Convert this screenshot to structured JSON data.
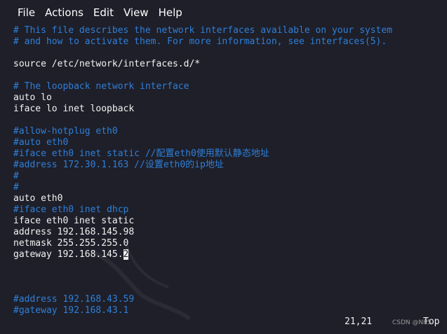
{
  "menu": [
    "File",
    "Actions",
    "Edit",
    "View",
    "Help"
  ],
  "lines": [
    {
      "type": "comment",
      "text": "# This file describes the network interfaces available on your system"
    },
    {
      "type": "comment",
      "text": "# and how to activate them. For more information, see interfaces(5)."
    },
    {
      "type": "blank",
      "text": ""
    },
    {
      "type": "normal",
      "text": "source /etc/network/interfaces.d/*"
    },
    {
      "type": "blank",
      "text": ""
    },
    {
      "type": "comment",
      "text": "# The loopback network interface"
    },
    {
      "type": "normal",
      "text": "auto lo"
    },
    {
      "type": "normal",
      "text": "iface lo inet loopback"
    },
    {
      "type": "blank",
      "text": ""
    },
    {
      "type": "comment",
      "text": "#allow-hotplug eth0"
    },
    {
      "type": "comment",
      "text": "#auto eth0"
    },
    {
      "type": "comment",
      "text": "#iface eth0 inet static //配置eth0使用默认静态地址"
    },
    {
      "type": "comment",
      "text": "#address 172.30.1.163 //设置eth0的ip地址"
    },
    {
      "type": "comment",
      "text": "#"
    },
    {
      "type": "comment",
      "text": "#"
    },
    {
      "type": "normal",
      "text": "auto eth0"
    },
    {
      "type": "comment",
      "text": "#iface eth0 inet dhcp"
    },
    {
      "type": "normal",
      "text": "iface eth0 inet static"
    },
    {
      "type": "normal",
      "text": "address 192.168.145.98"
    },
    {
      "type": "normal",
      "text": "netmask 255.255.255.0"
    },
    {
      "type": "cursor",
      "before": "gateway 192.168.145.",
      "cursor": "2",
      "after": ""
    },
    {
      "type": "blank",
      "text": ""
    },
    {
      "type": "blank",
      "text": ""
    },
    {
      "type": "blank",
      "text": ""
    },
    {
      "type": "comment",
      "text": "#address 192.168.43.59"
    },
    {
      "type": "comment",
      "text": "#gateway 192.168.43.1"
    }
  ],
  "status": {
    "position": "21,21",
    "scroll": "Top"
  },
  "watermark_text": "CSDN @NP5",
  "colors": {
    "background": "#1e1f29",
    "comment": "#2f7fd8",
    "text": "#f2f2f2"
  }
}
